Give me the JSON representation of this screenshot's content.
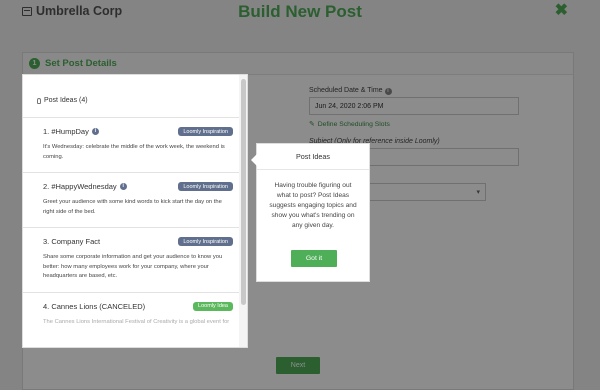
{
  "app": {
    "brand": "Umbrella Corp",
    "page_title": "Build New Post",
    "close_icon": "close-icon"
  },
  "card": {
    "step_number": "1",
    "step_title": "Set Post Details"
  },
  "form": {
    "scheduled_label": "Scheduled Date & Time",
    "scheduled_value": "Jun 24, 2020 2:06 PM",
    "define_slots_link": "Define Scheduling Slots",
    "subject_label": "Subject (Only for reference inside Loomly)"
  },
  "footer": {
    "next_label": "Next"
  },
  "ideas_panel": {
    "header": "Post Ideas (4)",
    "ideas": [
      {
        "title": "1. #HumpDay",
        "badge": "Loomly Inspiration",
        "text": "It's Wednesday: celebrate the middle of the work week, the weekend is coming."
      },
      {
        "title": "2. #HappyWednesday",
        "badge": "Loomly Inspiration",
        "text": "Greet your audience with some kind words to kick start the day on the right side of the bed."
      },
      {
        "title": "3. Company Fact",
        "badge": "Loomly Inspiration",
        "text": "Share some corporate information and get your audience to know you better: how many employees work for your company, where your headquarters are based, etc."
      },
      {
        "title": "4. Cannes Lions (CANCELED)",
        "badge": "Loomly Idea",
        "text": "The Cannes Lions International Festival of Creativity is a global event for"
      }
    ]
  },
  "popover": {
    "title": "Post Ideas",
    "body": "Having trouble figuring out what to post? Post Ideas suggests engaging topics and show you what's trending on any given day.",
    "button": "Got it"
  },
  "colors": {
    "accent": "#4fae58",
    "badge_inspiration": "#5f6f8d",
    "badge_idea": "#5cb85c"
  }
}
